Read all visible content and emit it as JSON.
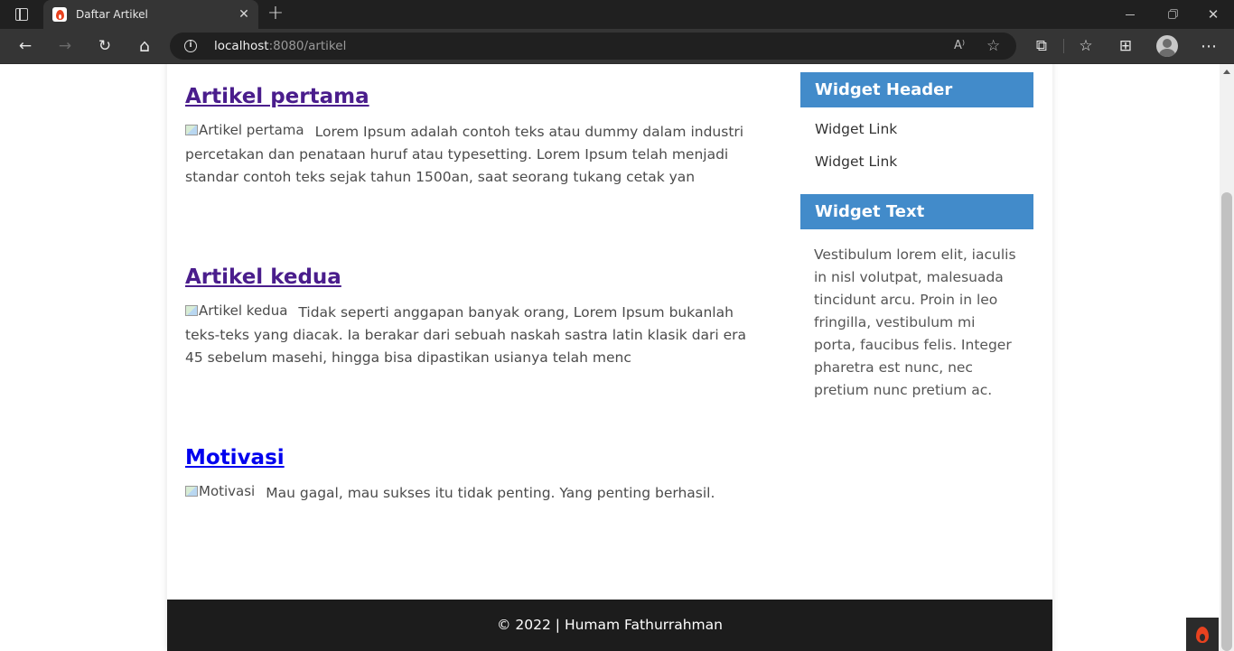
{
  "browser": {
    "tab_title": "Daftar Artikel",
    "tab_close": "✕",
    "new_tab": "+",
    "url_host": "localhost",
    "url_path": ":8080/artikel",
    "window_controls": {
      "minimize": "minimize-icon",
      "restore": "restore-icon",
      "close": "✕"
    },
    "toolbar_icons": {
      "back": "←",
      "forward": "→",
      "reload": "↻",
      "home": "⌂",
      "extensions": "⧉",
      "favorites": "☆",
      "collections": "⊞",
      "more": "⋯",
      "read_aloud": "A⁾",
      "add_favorite": "☆"
    }
  },
  "articles": [
    {
      "title": "Artikel pertama",
      "image_alt": "Artikel pertama",
      "excerpt": "Lorem Ipsum adalah contoh teks atau dummy dalam industri percetakan dan penataan huruf atau typesetting. Lorem Ipsum telah menjadi standar contoh teks sejak tahun 1500an, saat seorang tukang cetak yan"
    },
    {
      "title": "Artikel kedua",
      "image_alt": "Artikel kedua",
      "excerpt": "Tidak seperti anggapan banyak orang, Lorem Ipsum bukanlah teks-teks yang diacak. Ia berakar dari sebuah naskah sastra latin klasik dari era 45 sebelum masehi, hingga bisa dipastikan usianya telah menc"
    },
    {
      "title": "Motivasi",
      "image_alt": "Motivasi",
      "excerpt": "Mau gagal, mau sukses itu tidak penting. Yang penting berhasil."
    }
  ],
  "sidebar": {
    "widget_header": "Widget Header",
    "links": [
      "Widget Link",
      "Widget Link"
    ],
    "widget_text_title": "Widget Text",
    "widget_text": "Vestibulum lorem elit, iaculis in nisl volutpat, malesuada tincidunt arcu. Proin in leo fringilla, vestibulum mi porta, faucibus felis. Integer pharetra est nunc, nec pretium nunc pretium ac."
  },
  "footer": {
    "text": "© 2022 | Humam Fathurrahman"
  },
  "colors": {
    "widget_header_bg": "#428bca",
    "footer_bg": "#1c1c1c",
    "visited_link": "#4a1d8c",
    "link": "#0000ee"
  }
}
